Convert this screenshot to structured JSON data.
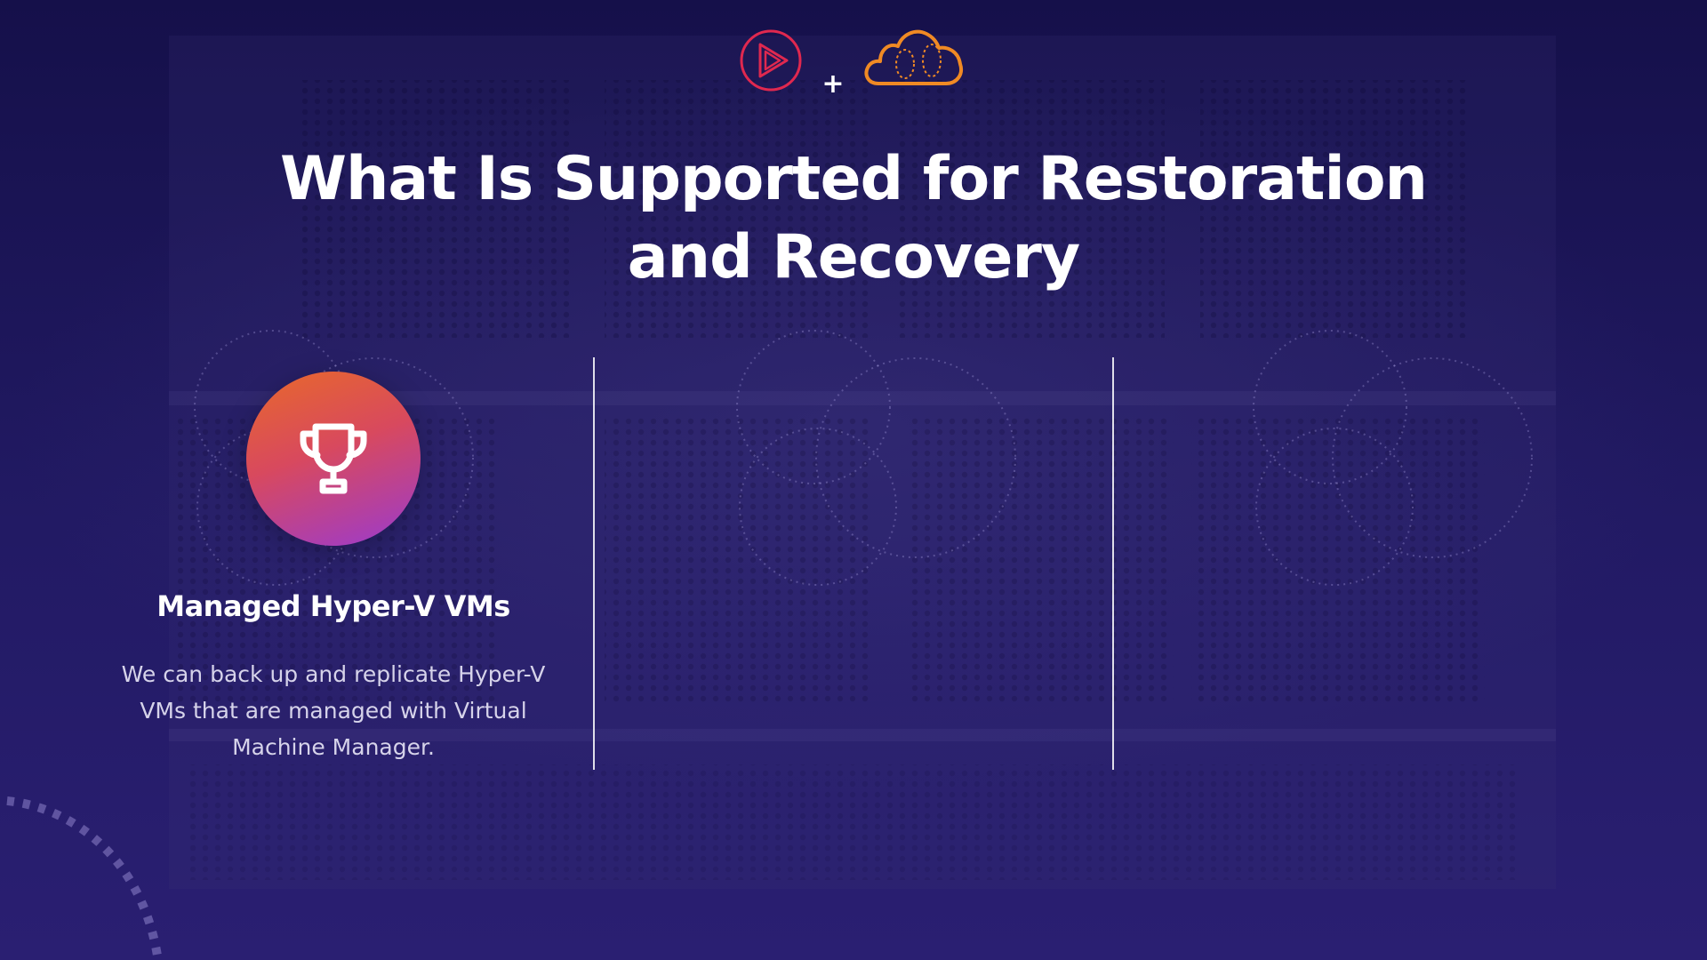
{
  "header": {
    "logos": [
      {
        "icon": "play-logo-icon",
        "color": "#e0284f"
      },
      {
        "icon": "plus-icon"
      },
      {
        "icon": "cloud-logo-icon",
        "color": "#f08a24"
      }
    ],
    "plus_symbol": "+"
  },
  "slide": {
    "title_line1": "What Is Supported for Restoration",
    "title_line2": "and Recovery"
  },
  "cards": [
    {
      "icon": "trophy-icon",
      "title": "Managed Hyper-V VMs",
      "description": "We can back up and replicate Hyper-V VMs that are managed with Virtual Machine Manager."
    }
  ],
  "colors": {
    "background": "#1c1654",
    "divider": "#ffffff",
    "icon_gradient_start": "#e8692a",
    "icon_gradient_end": "#9a3ad0",
    "description_text": "#d6d3ea"
  }
}
